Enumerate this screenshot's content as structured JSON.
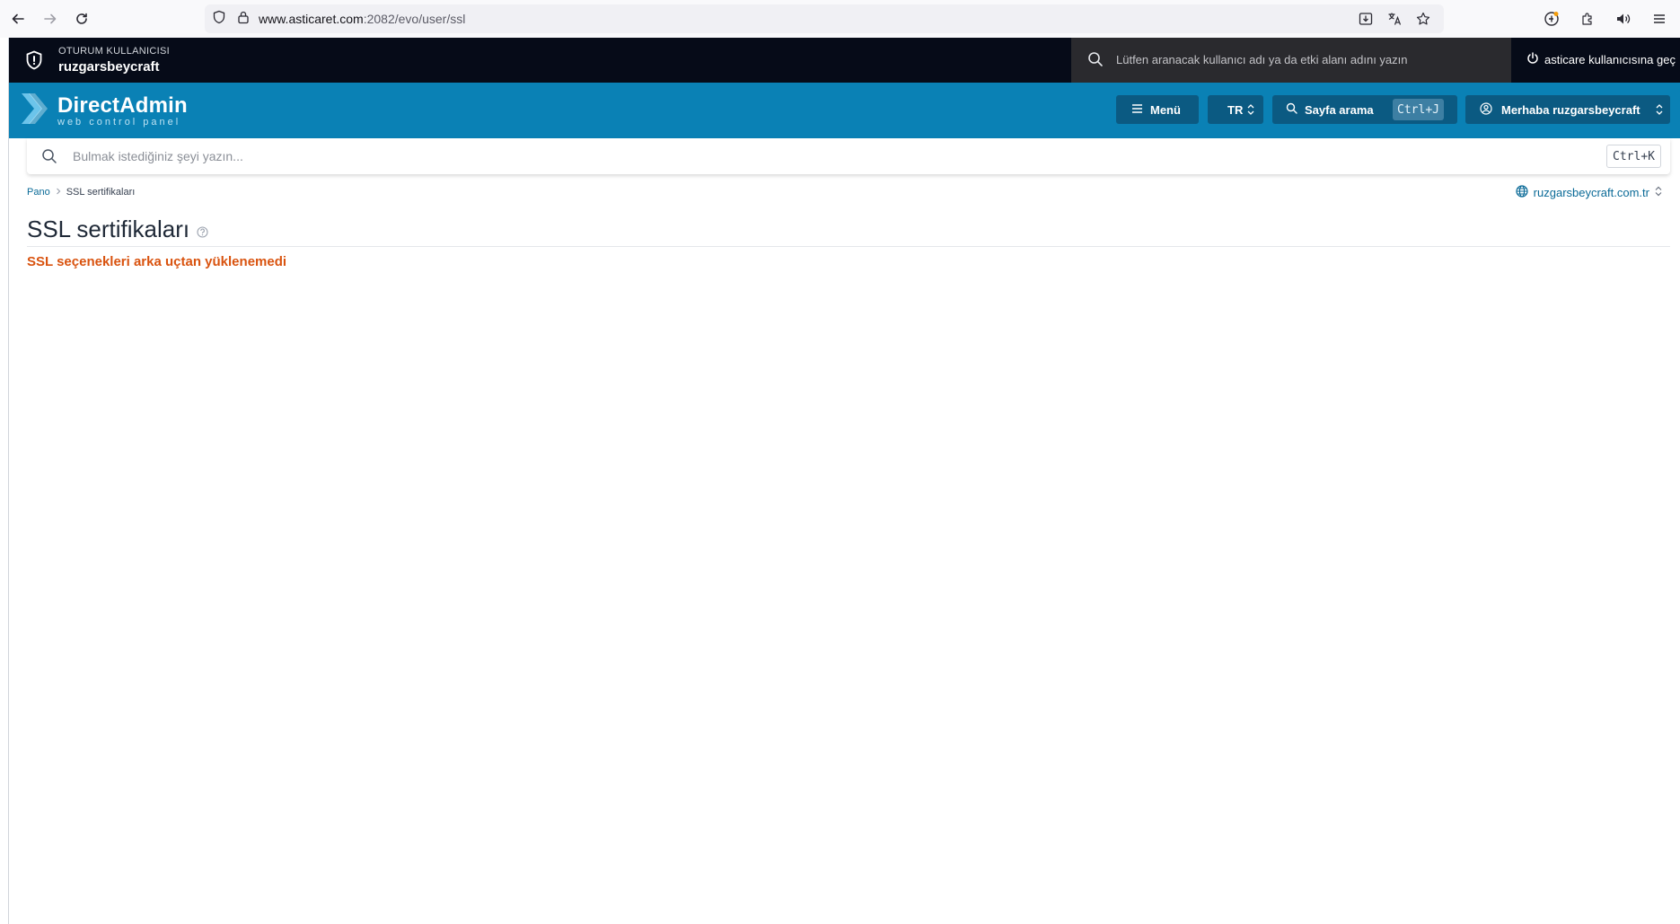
{
  "browser": {
    "url_host": "www.asticaret.com",
    "url_path": ":2082/evo/user/ssl"
  },
  "session": {
    "label": "OTURUM KULLANICISI",
    "username": "ruzgarsbeycraft",
    "search_placeholder": "Lütfen aranacak kullanıcı adı ya da etki alanı adını yazın",
    "switch_label": "asticare kullanıcısına geç"
  },
  "header": {
    "logo_title": "DirectAdmin",
    "logo_subtitle": "web control panel",
    "menu_label": "Menü",
    "lang_label": "TR",
    "page_search_label": "Sayfa arama",
    "page_search_shortcut": "Ctrl+J",
    "user_greeting": "Merhaba ruzgarsbeycraft",
    "brand_color": "#0a81b5"
  },
  "search": {
    "placeholder": "Bulmak istediğiniz şeyi yazın...",
    "shortcut": "Ctrl+K"
  },
  "breadcrumb": {
    "home": "Pano",
    "current": "SSL sertifikaları"
  },
  "domain": "ruzgarsbeycraft.com.tr",
  "page": {
    "title": "SSL sertifikaları",
    "error": "SSL seçenekleri arka uçtan yüklenemedi",
    "error_color": "#d9530f"
  }
}
